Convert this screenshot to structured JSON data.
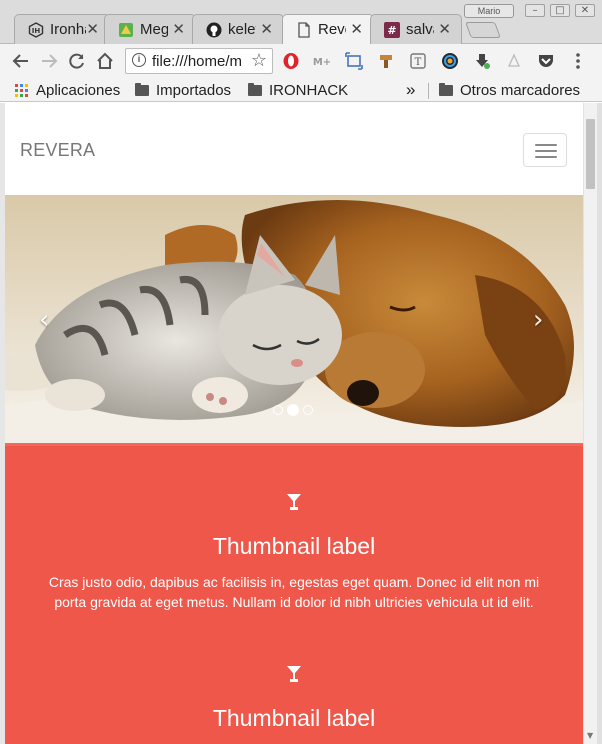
{
  "browser": {
    "tabs": [
      {
        "title": "Ironhack",
        "favicon": "ironhack-icon",
        "active": false
      },
      {
        "title": "Mega",
        "favicon": "mega-icon",
        "active": false
      },
      {
        "title": "kelevra",
        "favicon": "github-icon",
        "active": false
      },
      {
        "title": "Revera",
        "favicon": "page-icon",
        "active": true
      },
      {
        "title": "salvador",
        "favicon": "hash-icon",
        "active": false
      }
    ],
    "user_chip": "Mario",
    "address": "file:///home/m",
    "bookmarks": {
      "apps": "Aplicaciones",
      "items": [
        "Importados",
        "IRONHACK"
      ],
      "overflow": "»",
      "other": "Otros marcadores"
    }
  },
  "page": {
    "brand": "REVERA",
    "carousel": {
      "image": "kitten-and-puppy-sleeping",
      "prev": "‹",
      "next": "›",
      "slides": 3,
      "active_slide": 2
    },
    "thumbnails": [
      {
        "icon": "cocktail-glass-icon",
        "title": "Thumbnail label",
        "text": "Cras justo odio, dapibus ac facilisis in, egestas eget quam. Donec id elit non mi porta gravida at eget metus. Nullam id dolor id nibh ultricies vehicula ut id elit."
      },
      {
        "icon": "cocktail-glass-icon",
        "title": "Thumbnail label",
        "text": ""
      }
    ],
    "colors": {
      "section_red": "#ee5749",
      "brand_gray": "#777777"
    }
  }
}
